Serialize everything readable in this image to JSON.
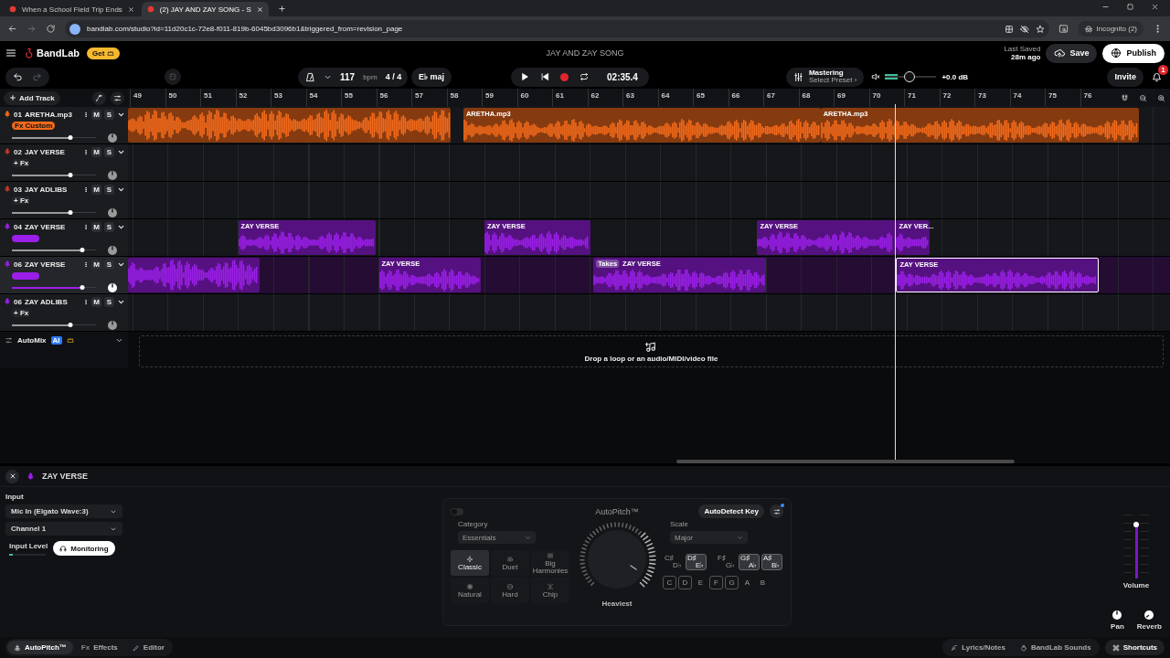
{
  "browser": {
    "tabs": [
      {
        "title": "When a School Field Trip Ends",
        "selected": false
      },
      {
        "title": "(2) JAY AND ZAY SONG - S",
        "selected": true
      }
    ],
    "url": "bandlab.com/studio?id=11d20c1c-72e8-f011-819b-6045bd3096b1&triggered_from=revision_page",
    "profile": "Incognito (2)"
  },
  "header": {
    "logo": "BandLab",
    "get_button": "Get",
    "song_title": "JAY AND ZAY SONG",
    "last_saved_label": "Last Saved",
    "last_saved_time": "28m ago",
    "save": "Save",
    "publish": "Publish"
  },
  "toolbar": {
    "tempo": "117",
    "tempo_unit": "bpm",
    "time_signature": "4 / 4",
    "key": "E♭ maj",
    "time": "02:35.4",
    "mastering": {
      "title": "Mastering",
      "preset": "Select Preset ›"
    },
    "master_volume": {
      "level": 0.48
    },
    "master_db": "+0.0 dB",
    "invite": "Invite",
    "notifications": "1"
  },
  "arrange": {
    "add_track": "Add Track",
    "ruler": [
      "49",
      "50",
      "51",
      "52",
      "53",
      "54",
      "55",
      "56",
      "57",
      "58",
      "59",
      "60",
      "61",
      "62",
      "63",
      "64",
      "65",
      "66",
      "67",
      "68",
      "69",
      "70",
      "71",
      "72",
      "73",
      "74",
      "75",
      "76"
    ],
    "tracks": [
      {
        "number": "01",
        "name": "ARETHA.mp3",
        "color": "#f26a1b",
        "mute": "M",
        "solo": "S",
        "fx": {
          "kind": "custom",
          "label": "Fx Custom"
        },
        "volume": {
          "level": 0.7
        },
        "selected": false,
        "clips": [
          {
            "selected": false
          },
          {
            "label": "ARETHA.mp3",
            "selected": false
          },
          {
            "label": "ARETHA.mp3",
            "selected": false
          }
        ]
      },
      {
        "number": "02",
        "name": "JAY VERSE",
        "color": "#c0392b",
        "mute": "M",
        "solo": "S",
        "fx": {
          "kind": "add",
          "label": "+ Fx"
        },
        "volume": {
          "level": 0.7
        },
        "selected": false
      },
      {
        "number": "03",
        "name": "JAY ADLIBS",
        "color": "#c0392b",
        "mute": "M",
        "solo": "S",
        "fx": {
          "kind": "add",
          "label": "+ Fx"
        },
        "volume": {
          "level": 0.7
        },
        "selected": false
      },
      {
        "number": "04",
        "name": "ZAY VERSE",
        "color": "#9b1fe8",
        "mute": "M",
        "solo": "S",
        "fx": {
          "kind": "preset"
        },
        "volume": {
          "level": 0.84
        },
        "selected": false,
        "clips": [
          {
            "label": "ZAY VERSE",
            "selected": false
          },
          {
            "label": "ZAY VERSE",
            "selected": false
          },
          {
            "label": "ZAY VERSE",
            "selected": false
          },
          {
            "label": "ZAY VER...",
            "selected": false
          }
        ]
      },
      {
        "number": "06",
        "name": "ZAY VERSE",
        "color": "#9b1fe8",
        "mute": "M",
        "solo": "S",
        "fx": {
          "kind": "preset"
        },
        "volume": {
          "level": 0.84
        },
        "selected": true,
        "clips": [
          {
            "selected": false
          },
          {
            "label": "ZAY VERSE",
            "selected": false
          },
          {
            "label": "ZAY VERSE",
            "takes": "Takes",
            "selected": false
          },
          {
            "label": "ZAY VERSE",
            "selected": true
          }
        ]
      },
      {
        "number": "06",
        "name": "ZAY ADLIBS",
        "color": "#9b1fe8",
        "mute": "M",
        "solo": "S",
        "fx": {
          "kind": "add",
          "label": "+ Fx"
        },
        "volume": {
          "level": 0.7
        },
        "selected": false
      }
    ],
    "automix": {
      "label": "AutoMix",
      "badge": "AI"
    },
    "drop_zone": "Drop a loop or an audio/MIDI/video file"
  },
  "panel": {
    "track_name": "ZAY VERSE",
    "input_label": "Input",
    "input_device": "Mic In (Elgato Wave:3)",
    "input_channel": "Channel 1",
    "input_level_label": "Input Level",
    "input_level": {
      "level": 0.1
    },
    "monitoring": {
      "label": "Monitoring",
      "on": true
    },
    "autopitch": {
      "on": false,
      "title": "AutoPitch™",
      "detect_key": "AutoDetect Key",
      "category_label": "Category",
      "category": "Essentials",
      "presets": [
        {
          "label": "Classic",
          "kind": "classic",
          "selected": true
        },
        {
          "label": "Duet",
          "kind": "duet",
          "selected": false
        },
        {
          "label": "Big Harmonies",
          "kind": "harmonies",
          "selected": false
        },
        {
          "label": "Natural",
          "kind": "natural",
          "selected": false
        },
        {
          "label": "Hard",
          "kind": "hard",
          "selected": false
        },
        {
          "label": "Chip",
          "kind": "chip",
          "selected": false
        }
      ],
      "strength": "Heaviest",
      "scale_label": "Scale",
      "scale": "Major",
      "black_keys": [
        {
          "sharp": "C♯",
          "flat": "D♭",
          "on": false
        },
        {
          "sharp": "D♯",
          "flat": "E♭",
          "on": true
        },
        {
          "sharp": "F♯",
          "flat": "G♭",
          "on": false
        },
        {
          "sharp": "G♯",
          "flat": "A♭",
          "on": true
        },
        {
          "sharp": "A♯",
          "flat": "B♭",
          "on": true
        }
      ],
      "white_keys": [
        {
          "label": "C",
          "on": true
        },
        {
          "label": "D",
          "on": true
        },
        {
          "label": "E",
          "on": false
        },
        {
          "label": "F",
          "on": true
        },
        {
          "label": "G",
          "on": true
        },
        {
          "label": "A",
          "on": false
        },
        {
          "label": "B",
          "on": false
        }
      ]
    },
    "volume": {
      "label": "Volume",
      "level": 0.85
    },
    "pan": "Pan",
    "reverb": "Reverb"
  },
  "footer": {
    "tabs": [
      {
        "label": "AutoPitch™",
        "kind": "autopitch",
        "selected": true
      },
      {
        "label": "Effects",
        "icon_text": "Fx",
        "kind": "effects",
        "selected": false
      },
      {
        "label": "Editor",
        "kind": "editor",
        "selected": false
      }
    ],
    "tools": [
      {
        "label": "Lyrics/Notes",
        "kind": "lyrics"
      },
      {
        "label": "BandLab Sounds",
        "kind": "sounds"
      }
    ],
    "shortcuts": "Shortcuts"
  }
}
